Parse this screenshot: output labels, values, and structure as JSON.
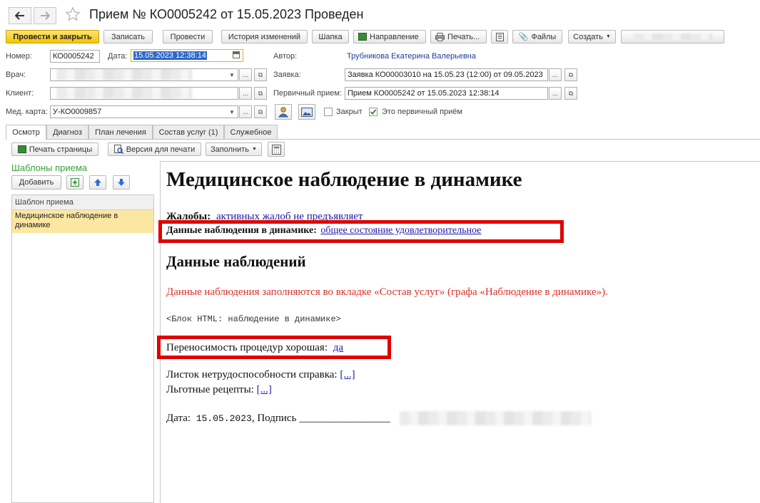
{
  "window": {
    "title": "Прием № КО0005242 от 15.05.2023 Проведен"
  },
  "toolbar": {
    "post_close": "Провести и закрыть",
    "save": "Записать",
    "post": "Провести",
    "history": "История изменений",
    "header": "Шапка",
    "referral": "Направление",
    "print": "Печать...",
    "files": "Файлы",
    "create": "Создать"
  },
  "form": {
    "number_label": "Номер:",
    "number_value": "КО0005242",
    "date_label": "Дата:",
    "date_value": "15.05.2023 12:38:14",
    "author_label": "Автор:",
    "author_value": "Трубникова Екатерина Валерьевна",
    "doctor_label": "Врач:",
    "request_label": "Заявка:",
    "request_value": "Заявка КО00003010 на 15.05.23 (12:00) от 09.05.2023",
    "client_label": "Клиент:",
    "primary_label": "Первичный прием:",
    "primary_value": "Прием КО0005242 от 15.05.2023 12:38:14",
    "medcard_label": "Мед. карта:",
    "medcard_value": "У-КО0009857",
    "closed_label": "Закрыт",
    "closed_checked": false,
    "is_primary_label": "Это первичный приём",
    "is_primary_checked": true
  },
  "tabs": [
    "Осмотр",
    "Диагноз",
    "План лечения",
    "Состав услуг (1)",
    "Служебное"
  ],
  "subtoolbar": {
    "print_page": "Печать страницы",
    "print_version": "Версия для печати",
    "fill": "Заполнить"
  },
  "templates": {
    "title": "Шаблоны приема",
    "add": "Добавить",
    "column": "Шаблон приема",
    "items": [
      "Медицинское наблюдение в динамике"
    ]
  },
  "document": {
    "heading": "Медицинское наблюдение в динамике",
    "complaints_label": "Жалобы:",
    "complaints_value": "активных жалоб не предъявляет",
    "dynamics_label": "Данные наблюдения в динамике:",
    "dynamics_value": "общее состояние удовлетворительное",
    "section_heading": "Данные наблюдений",
    "red_note": "Данные наблюдения заполняются во вкладке «Состав услуг» (графа «Наблюдение в динамике»).",
    "html_block": "<Блок HTML: наблюдение в динамике>",
    "tolerance_label": "Переносимость процедур хорошая:",
    "tolerance_value": "да",
    "sick_leave_label": "Листок нетрудоспособности справка:",
    "sick_leave_value": "[...]",
    "prescriptions_label": "Льготные рецепты:",
    "prescriptions_value": "[...]",
    "date_label": "Дата:",
    "date_value": "15.05.2023",
    "signature_label": "Подпись",
    "signature_line": "_________________"
  },
  "colors": {
    "primary_button": "#f5c400",
    "highlight_row": "#fbe7a1",
    "red_box": "#e00000",
    "red_note": "#d9302b",
    "link": "#1a1aa8",
    "section_green": "#3aa03a"
  }
}
